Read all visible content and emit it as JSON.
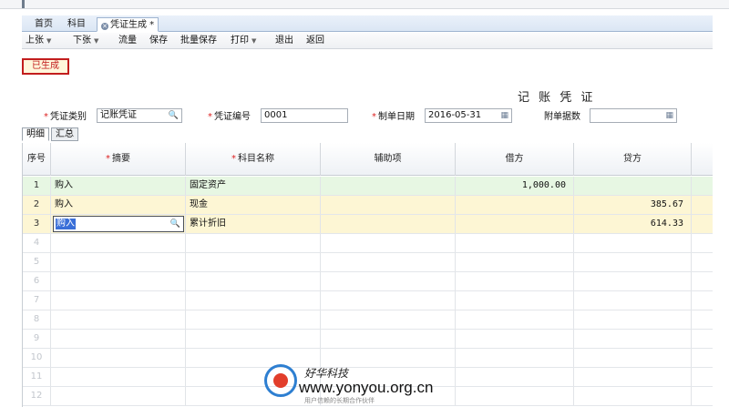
{
  "tabs": [
    {
      "label": "首页"
    },
    {
      "label": "科目"
    },
    {
      "label": "凭证生成 *"
    }
  ],
  "toolbar": {
    "prev": "上张",
    "next": "下张",
    "flow": "流量",
    "save": "保存",
    "batch_save": "批量保存",
    "print": "打印",
    "exit": "退出",
    "back": "返回"
  },
  "status": "已生成",
  "voucher_title": "记 账 凭 证",
  "form": {
    "type_label": "凭证类别",
    "type_value": "记账凭证",
    "number_label": "凭证编号",
    "number_value": "0001",
    "date_label": "制单日期",
    "date_value": "2016-05-31",
    "attach_label": "附单据数",
    "attach_value": ""
  },
  "subtabs": [
    {
      "label": "明细"
    },
    {
      "label": "汇总"
    }
  ],
  "grid": {
    "headers": {
      "seq": "序号",
      "summary": "摘要",
      "account": "科目名称",
      "aux": "辅助项",
      "debit": "借方",
      "credit": "贷方"
    },
    "rows": [
      {
        "seq": "1",
        "summary": "购入",
        "account": "固定资产",
        "aux": "",
        "debit": "1,000.00",
        "credit": ""
      },
      {
        "seq": "2",
        "summary": "购入",
        "account": "现金",
        "aux": "",
        "debit": "",
        "credit": "385.67"
      },
      {
        "seq": "3",
        "summary": "购入",
        "account": "累计折旧",
        "aux": "",
        "debit": "",
        "credit": "614.33"
      }
    ],
    "empty_rows": [
      "4",
      "5",
      "6",
      "7",
      "8",
      "9",
      "10",
      "11",
      "12"
    ]
  },
  "watermark": {
    "brand": "好华科技",
    "url": "www.yonyou.org.cn",
    "sub": "用户信赖的长期合作伙伴"
  }
}
